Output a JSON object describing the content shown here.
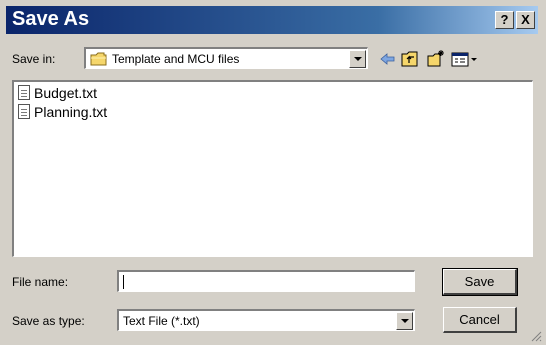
{
  "window": {
    "title": "Save As",
    "help_label": "?",
    "close_label": "X"
  },
  "save_in": {
    "label": "Save in:",
    "value": "Template and MCU files"
  },
  "toolbar": {
    "icons": [
      "back-icon",
      "up-folder-icon",
      "new-folder-icon",
      "view-menu-icon"
    ]
  },
  "files": [
    {
      "name": "Budget.txt"
    },
    {
      "name": "Planning.txt"
    }
  ],
  "file_name": {
    "label": "File name:",
    "value": ""
  },
  "save_as_type": {
    "label": "Save as type:",
    "value": "Text File (*.txt)"
  },
  "buttons": {
    "save": "Save",
    "cancel": "Cancel"
  }
}
